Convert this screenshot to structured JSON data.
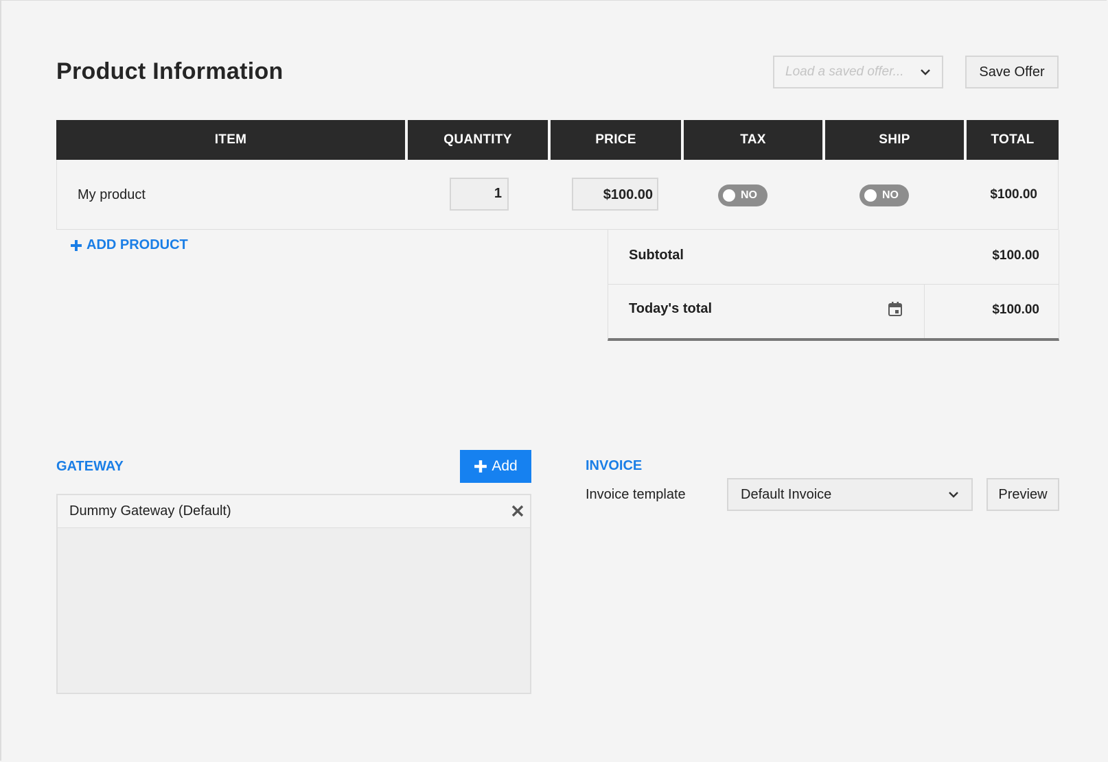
{
  "header": {
    "title": "Product Information",
    "offer_select_placeholder": "Load a saved offer...",
    "save_label": "Save Offer"
  },
  "table": {
    "columns": [
      "ITEM",
      "QUANTITY",
      "PRICE",
      "TAX",
      "SHIP",
      "TOTAL"
    ],
    "rows": [
      {
        "item": "My product",
        "quantity": "1",
        "price": "$100.00",
        "tax": "NO",
        "ship": "NO",
        "total": "$100.00"
      }
    ],
    "add_product_label": "ADD PRODUCT"
  },
  "totals": {
    "subtotal_label": "Subtotal",
    "subtotal_value": "$100.00",
    "today_label": "Today's total",
    "today_value": "$100.00"
  },
  "gateway": {
    "title": "GATEWAY",
    "add_label": "Add",
    "selected": "Dummy Gateway (Default)"
  },
  "invoice": {
    "title": "INVOICE",
    "template_label": "Invoice template",
    "template_value": "Default Invoice",
    "preview_label": "Preview"
  },
  "colors": {
    "accent": "#1a7ee6",
    "header_bg": "#2a2a2a",
    "toggle_off": "#8d8d8d"
  },
  "icons": [
    "chevron-down-icon",
    "plus-icon",
    "calendar-icon",
    "close-icon"
  ]
}
